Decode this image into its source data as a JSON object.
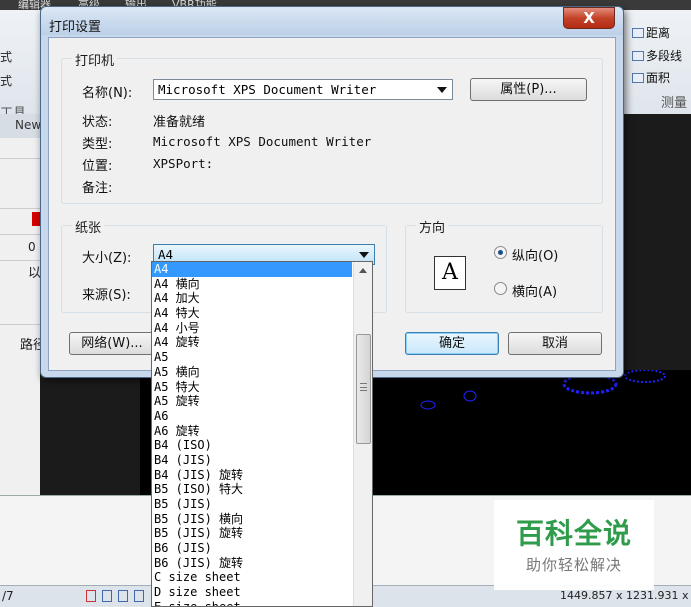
{
  "background": {
    "menu": [
      "编辑器",
      "高级",
      "输出",
      "VBR功能"
    ],
    "left_panel": {
      "items": [
        "式",
        "式"
      ],
      "tool_label": "工具",
      "new_tab": "New"
    },
    "right_tools": {
      "distance": "距离",
      "polyline": "多段线",
      "area": "面积",
      "measure": "测量"
    },
    "left_values": {
      "zero": "0",
      "yi": "以",
      "path": "路径"
    },
    "status": {
      "left": "/7",
      "coords": "1449.857 x 1231.931 x"
    }
  },
  "watermark": {
    "main": "百科全说",
    "sub": "助你轻松解决"
  },
  "dialog": {
    "title": "打印设置",
    "close_label": "X",
    "printer": {
      "group_title": "打印机",
      "name_label": "名称(N):",
      "name_value": "Microsoft XPS Document Writer",
      "properties_button": "属性(P)...",
      "status_label": "状态:",
      "status_value": "准备就绪",
      "type_label": "类型:",
      "type_value": "Microsoft XPS Document Writer",
      "location_label": "位置:",
      "location_value": "XPSPort:",
      "comment_label": "备注:",
      "comment_value": ""
    },
    "paper": {
      "group_title": "纸张",
      "size_label": "大小(Z):",
      "size_value": "A4",
      "source_label": "来源(S):"
    },
    "orientation": {
      "group_title": "方向",
      "icon_letter": "A",
      "portrait_label": "纵向(O)",
      "landscape_label": "横向(A)",
      "selected": "portrait"
    },
    "network_button": "网络(W)...",
    "ok_button": "确定",
    "cancel_button": "取消"
  },
  "dropdown": {
    "selected_index": 0,
    "items": [
      "A4",
      "A4 横向",
      "A4 加大",
      "A4 特大",
      "A4 小号",
      "A4 旋转",
      "A5",
      "A5 横向",
      "A5 特大",
      "A5 旋转",
      "A6",
      "A6 旋转",
      "B4 (ISO)",
      "B4 (JIS)",
      "B4 (JIS) 旋转",
      "B5 (ISO) 特大",
      "B5 (JIS)",
      "B5 (JIS) 横向",
      "B5 (JIS) 旋转",
      "B6 (JIS)",
      "B6 (JIS) 旋转",
      "C size sheet",
      "D size sheet",
      "E size sheet"
    ]
  },
  "colors": {
    "selection": "#3399ff",
    "close_button": "#c3432a",
    "watermark_green": "#2f9c4b"
  }
}
